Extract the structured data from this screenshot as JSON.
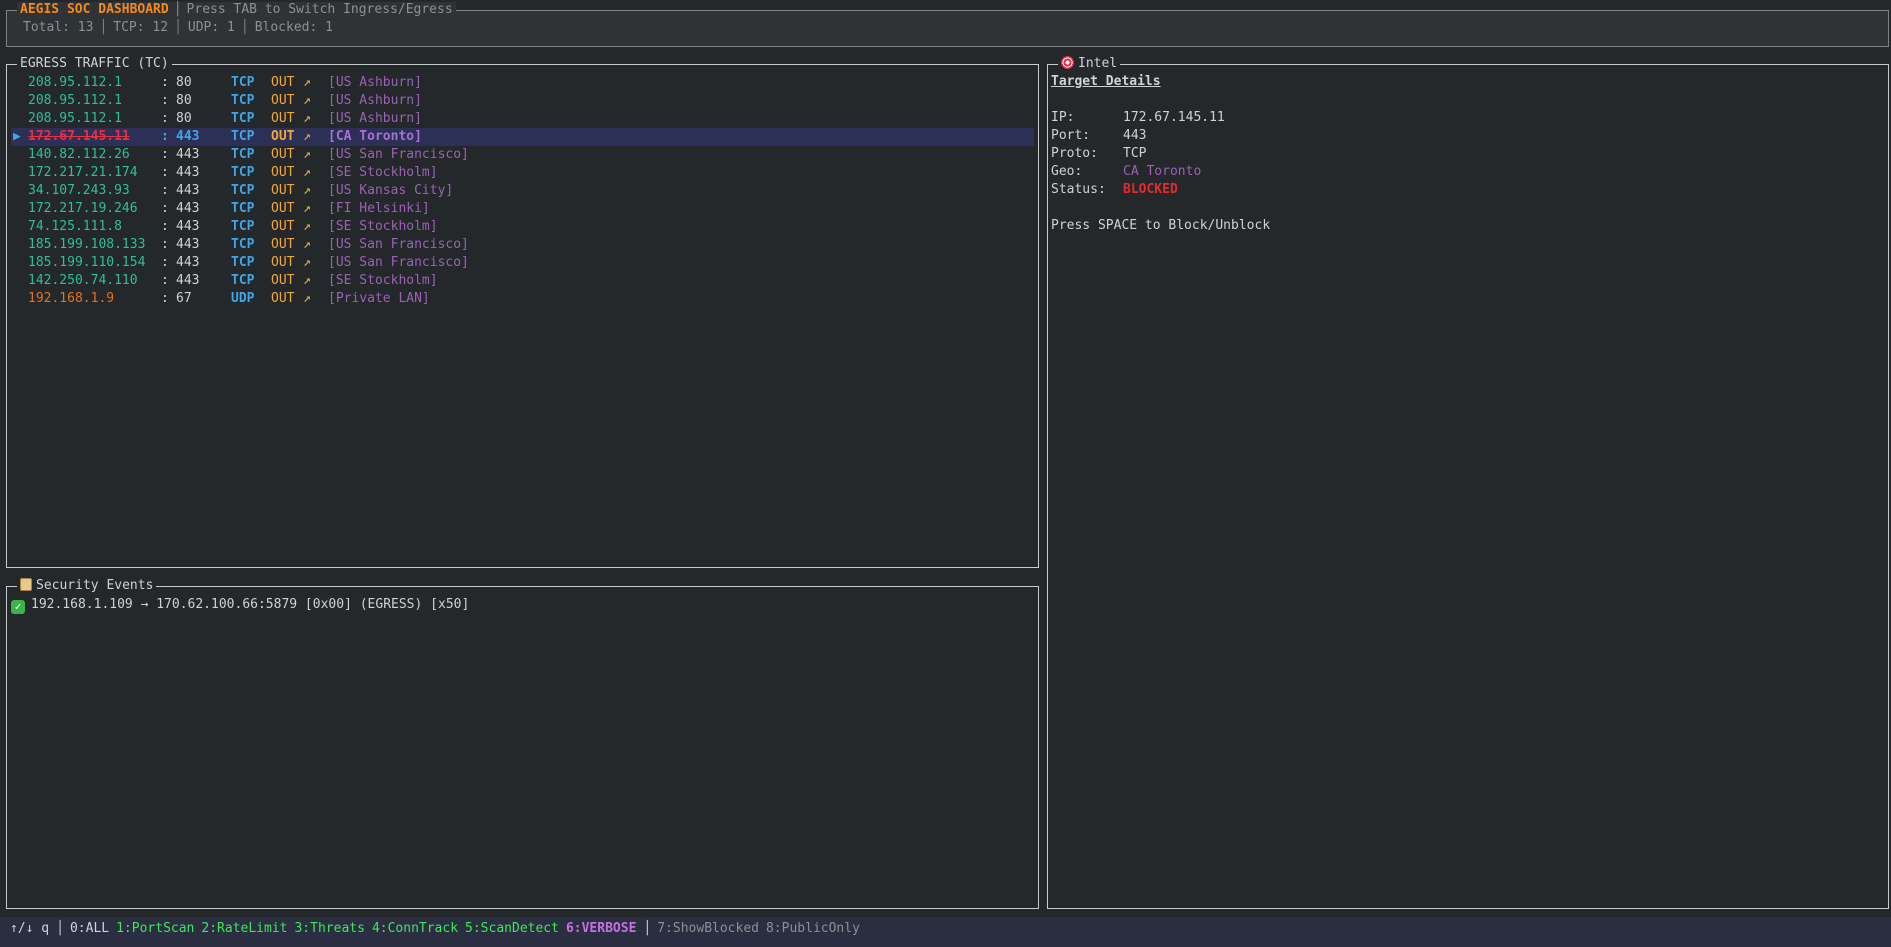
{
  "header": {
    "brand": "AEGIS SOC DASHBOARD",
    "hint": "Press TAB to Switch Ingress/Egress",
    "stats": {
      "total": "Total: 13",
      "tcp": "TCP: 12",
      "udp": "UDP: 1",
      "blocked": "Blocked: 1"
    }
  },
  "traffic": {
    "title": "EGRESS TRAFFIC (TC)",
    "rows": [
      {
        "ip": "208.95.112.1",
        "port": "80",
        "proto": "TCP",
        "dir": "OUT",
        "arrow": "↗",
        "geo": "[US Ashburn]"
      },
      {
        "ip": "208.95.112.1",
        "port": "80",
        "proto": "TCP",
        "dir": "OUT",
        "arrow": "↗",
        "geo": "[US Ashburn]"
      },
      {
        "ip": "208.95.112.1",
        "port": "80",
        "proto": "TCP",
        "dir": "OUT",
        "arrow": "↗",
        "geo": "[US Ashburn]"
      },
      {
        "ip": "172.67.145.11",
        "port": "443",
        "proto": "TCP",
        "dir": "OUT",
        "arrow": "↗",
        "geo": "[CA Toronto]",
        "selected": true,
        "blocked": true,
        "marker": "▶"
      },
      {
        "ip": "140.82.112.26",
        "port": "443",
        "proto": "TCP",
        "dir": "OUT",
        "arrow": "↗",
        "geo": "[US San Francisco]"
      },
      {
        "ip": "172.217.21.174",
        "port": "443",
        "proto": "TCP",
        "dir": "OUT",
        "arrow": "↗",
        "geo": "[SE Stockholm]"
      },
      {
        "ip": "34.107.243.93",
        "port": "443",
        "proto": "TCP",
        "dir": "OUT",
        "arrow": "↗",
        "geo": "[US Kansas City]"
      },
      {
        "ip": "172.217.19.246",
        "port": "443",
        "proto": "TCP",
        "dir": "OUT",
        "arrow": "↗",
        "geo": "[FI Helsinki]"
      },
      {
        "ip": "74.125.111.8",
        "port": "443",
        "proto": "TCP",
        "dir": "OUT",
        "arrow": "↗",
        "geo": "[SE Stockholm]"
      },
      {
        "ip": "185.199.108.133",
        "port": "443",
        "proto": "TCP",
        "dir": "OUT",
        "arrow": "↗",
        "geo": "[US San Francisco]"
      },
      {
        "ip": "185.199.110.154",
        "port": "443",
        "proto": "TCP",
        "dir": "OUT",
        "arrow": "↗",
        "geo": "[US San Francisco]"
      },
      {
        "ip": "142.250.74.110",
        "port": "443",
        "proto": "TCP",
        "dir": "OUT",
        "arrow": "↗",
        "geo": "[SE Stockholm]"
      },
      {
        "ip": "192.168.1.9",
        "port": "67",
        "proto": "UDP",
        "dir": "OUT",
        "arrow": "↗",
        "geo": "[Private LAN]",
        "private": true
      }
    ]
  },
  "intel": {
    "title": "Intel",
    "heading": "Target Details",
    "ip_label": "IP:",
    "ip": "172.67.145.11",
    "port_label": "Port:",
    "port": "443",
    "proto_label": "Proto:",
    "proto": "TCP",
    "geo_label": "Geo:",
    "geo": "CA Toronto",
    "status_label": "Status:",
    "status": "BLOCKED",
    "hint": "Press SPACE to Block/Unblock"
  },
  "events": {
    "title": "Security Events",
    "items": [
      {
        "text": "192.168.1.109 → 170.62.100.66:5879 [0x00] (EGRESS) [x50]"
      }
    ]
  },
  "footer": {
    "nav": "↑/↓ q",
    "all": "0:ALL",
    "filters": [
      "1:PortScan",
      "2:RateLimit",
      "3:Threats",
      "4:ConnTrack",
      "5:ScanDetect"
    ],
    "verbose": "6:VERBOSE",
    "extra": [
      "7:ShowBlocked",
      "8:PublicOnly"
    ]
  },
  "colors": {
    "background": "#24282a",
    "brand": "#f28b1d",
    "ip": "#2fbf9b",
    "proto": "#3fa7e8",
    "geo": "#9a62b5",
    "blocked": "#e43148",
    "filter": "#3ee65a",
    "verbose": "#c571e0"
  }
}
